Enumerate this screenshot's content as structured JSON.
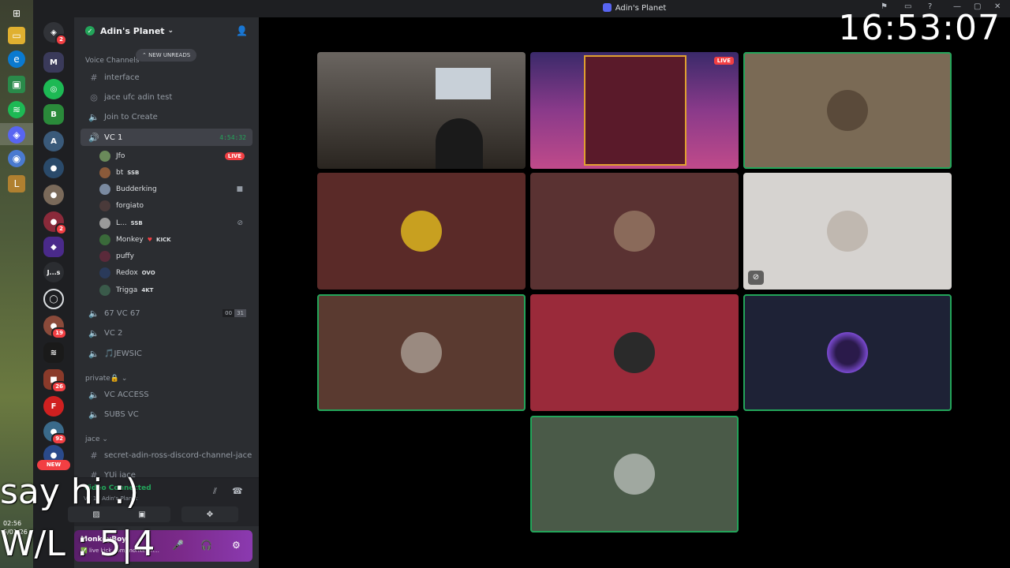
{
  "window": {
    "title": "Adin's Planet"
  },
  "overlay": {
    "clock": "16:53:07",
    "say_hi": "say hi :)",
    "wl": "W/L : 5|4"
  },
  "taskbar": {
    "time": "02:56",
    "date": "5/01/26"
  },
  "servers": {
    "badges": [
      "2",
      "2",
      "19",
      "26",
      "92"
    ],
    "abbrev_js": "J...s",
    "new_label": "NEW"
  },
  "guild": {
    "name": "Adin's Planet"
  },
  "sidebar": {
    "category_voice": "Voice Channels",
    "new_unreads": "NEW UNREADS",
    "channels_top": [
      {
        "name": "interface",
        "icon": "hash-icon"
      },
      {
        "name": "jace ufc adin test",
        "icon": "stage-icon"
      },
      {
        "name": "Join to Create",
        "icon": "speaker-icon"
      }
    ],
    "active_channel": {
      "name": "VC 1",
      "timer": "4:54:32"
    },
    "members": [
      {
        "name": "Jfo",
        "tag": "",
        "live": "LIVE",
        "color": "#6a8a5a"
      },
      {
        "name": "bt",
        "tag": "SSB",
        "color": "#8a5a3a"
      },
      {
        "name": "Budderking",
        "tag": "",
        "color": "#7a8aa0"
      },
      {
        "name": "forgiato",
        "tag": "",
        "color": "#4a3a3a"
      },
      {
        "name": "L...",
        "tag": "SSB",
        "color": "#9a9a9a"
      },
      {
        "name": "Monkey",
        "tag": "KICK",
        "color": "#3a6a3a"
      },
      {
        "name": "puffy",
        "tag": "",
        "color": "#5a2a3a"
      },
      {
        "name": "Redox",
        "tag": "OVO",
        "color": "#2a3a5a"
      },
      {
        "name": "Trigga",
        "tag": "4KT",
        "color": "#3a5a4a"
      }
    ],
    "channels_mid": [
      {
        "name": "67 VC 67",
        "count_a": "00",
        "count_b": "31"
      },
      {
        "name": "VC 2"
      },
      {
        "name": "🎵JEWSIC"
      }
    ],
    "category_private": "private🔒",
    "channels_private": [
      "VC ACCESS",
      "SUBS VC"
    ],
    "category_jace": "jace",
    "channels_jace": [
      "secret-adin-ross-discord-channel-jace",
      "YUj jace"
    ]
  },
  "voice_panel": {
    "status": "Video Connected",
    "sub": "VC 1 / Adin's Planet"
  },
  "user_panel": {
    "name": "MonkeyBoy",
    "status": "✅ live kick.com/monkeyin..."
  },
  "tiles": [
    {
      "bg": "#3a3530",
      "type": "camera",
      "speaking": false
    },
    {
      "bg": "#6b2a6b",
      "type": "stream",
      "live": "LIVE",
      "speaking": false
    },
    {
      "bg": "#7a6a55",
      "speaking": true,
      "avatar": "#5a4a3a"
    },
    {
      "bg": "#5a2a28",
      "speaking": false,
      "avatar": "#c8a020"
    },
    {
      "bg": "#5a3232",
      "speaking": false,
      "avatar": "#8a6a5a"
    },
    {
      "bg": "#d6d3d0",
      "speaking": false,
      "avatar": "#c0b8b0",
      "muted": true
    },
    {
      "bg": "#5a3a30",
      "speaking": true,
      "avatar": "#9a8a80"
    },
    {
      "bg": "#9a2a3a",
      "speaking": false,
      "avatar": "#2a2a2a"
    },
    {
      "bg": "#1e2236",
      "speaking": true,
      "avatar": "#6a3aa0"
    },
    {
      "bg": "#4a5a48",
      "speaking": true,
      "avatar": "#a0a8a0"
    }
  ]
}
